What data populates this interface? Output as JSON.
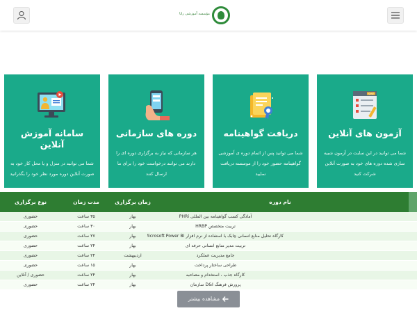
{
  "header": {
    "logo_text": "مؤسسه آموزشی رایا",
    "user_icon": "user-icon",
    "menu_icon": "hamburger-menu-icon"
  },
  "cards": [
    {
      "title": "آزمون های آنلاین",
      "description": "شما می توانید در این سایت در آزمون شبیه سازی شده دوره های خود به صورت آنلاین شرکت کنید",
      "icon": "quiz-checklist-icon"
    },
    {
      "title": "دریافت گواهینامه",
      "description": "شما می توانید پس از اتمام دوره ی آموزشی گواهینامه حضور خود را از موسسه دریافت نمایید",
      "icon": "certificate-icon"
    },
    {
      "title": "دوره های سازمانی",
      "description": "هر سازمانی که نیاز به برگزاری دوره ای را دارند می توانند درخواست خود را برای ما ارسال کنند",
      "icon": "mobile-hand-icon"
    },
    {
      "title": "سامانه آموزش آنلاین",
      "description": "شما می توانید در منزل و یا محل کار خود به صورت آنلاین دوره مورد نظر خود را بگذرانید",
      "icon": "online-teaching-icon"
    }
  ],
  "table": {
    "headers": {
      "name": "نام دوره",
      "time": "زمان برگزاری",
      "duration": "مدت زمان",
      "type": "نوع برگزاری"
    },
    "rows": [
      {
        "name": "آمادگی کسب گواهینامه بین المللی PHRi",
        "time": "بهار",
        "duration": "۳۵ ساعت",
        "type": "حضوری"
      },
      {
        "name": "تربیت متخصص HRBP",
        "time": "بهار",
        "duration": "۳۰ ساعت",
        "type": "حضوری"
      },
      {
        "name": "کارگاه تحلیل منابع انسانی چابک با استفاده از نرم افزار Microsoft Power BI",
        "time": "بهار",
        "duration": "۲۷ ساعت",
        "type": "حضوری"
      },
      {
        "name": "تربیت مدیر منابع انسانی حرفه ای",
        "time": "بهار",
        "duration": "۲۴ ساعت",
        "type": "حضوری"
      },
      {
        "name": "جامع مدیریت عملکرد",
        "time": "اردیبهشت",
        "duration": "۲۴ ساعت",
        "type": "حضوری"
      },
      {
        "name": "طراحی ساختار پرداخت",
        "time": "بهار",
        "duration": "۱۵ ساعت",
        "type": "حضوری"
      },
      {
        "name": "کارگاه جذب ، استخدام و مصاحبه",
        "time": "بهار",
        "duration": "۲۴ ساعت",
        "type": "حضوری / آنلاین"
      },
      {
        "name": "پرورش فرهنگ D&I سازمان",
        "time": "بهار",
        "duration": "۲۴ ساعت",
        "type": "حضوری"
      }
    ]
  },
  "more_button": {
    "label": "مشاهده بیشتر",
    "icon": "arrow-left-icon"
  },
  "colors": {
    "card_bg": "#1aaa8a",
    "table_header_bg": "#2e7d32",
    "button_bg": "#8a8f96"
  }
}
